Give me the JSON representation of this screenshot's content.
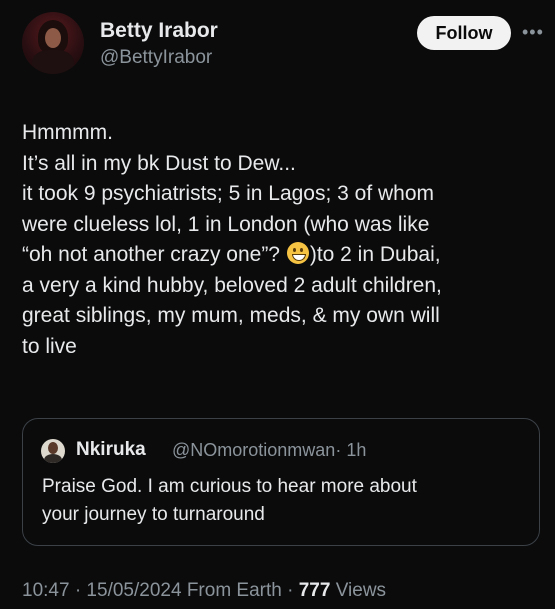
{
  "author": {
    "name": "Betty Irabor",
    "handle": "@BettyIrabor",
    "follow_label": "Follow",
    "more_icon": "more-horizontal-icon"
  },
  "tweet": {
    "lines": [
      "Hmmmm.",
      "It’s all in my bk Dust to Dew...",
      "it took 9 psychiatrists; 5 in Lagos; 3 of whom",
      "were clueless lol, 1 in London (who was like",
      "“oh not another  crazy one”? ",
      ")to 2 in Dubai,",
      "a very a kind hubby, beloved 2 adult children,",
      "great siblings, my mum, meds, & my own will",
      "to live"
    ],
    "emoji": "grinning-face-emoji"
  },
  "quote": {
    "name": "Nkiruka",
    "handle": "@NOmorotionmwan",
    "time": "· 1h",
    "lines": [
      "Praise God. I am curious to hear more about",
      "your journey to turnaround"
    ]
  },
  "footer": {
    "time": "10:47",
    "date": "· 15/05/2024",
    "source": "From Earth ·",
    "views_count": "777",
    "views_label": "Views"
  }
}
